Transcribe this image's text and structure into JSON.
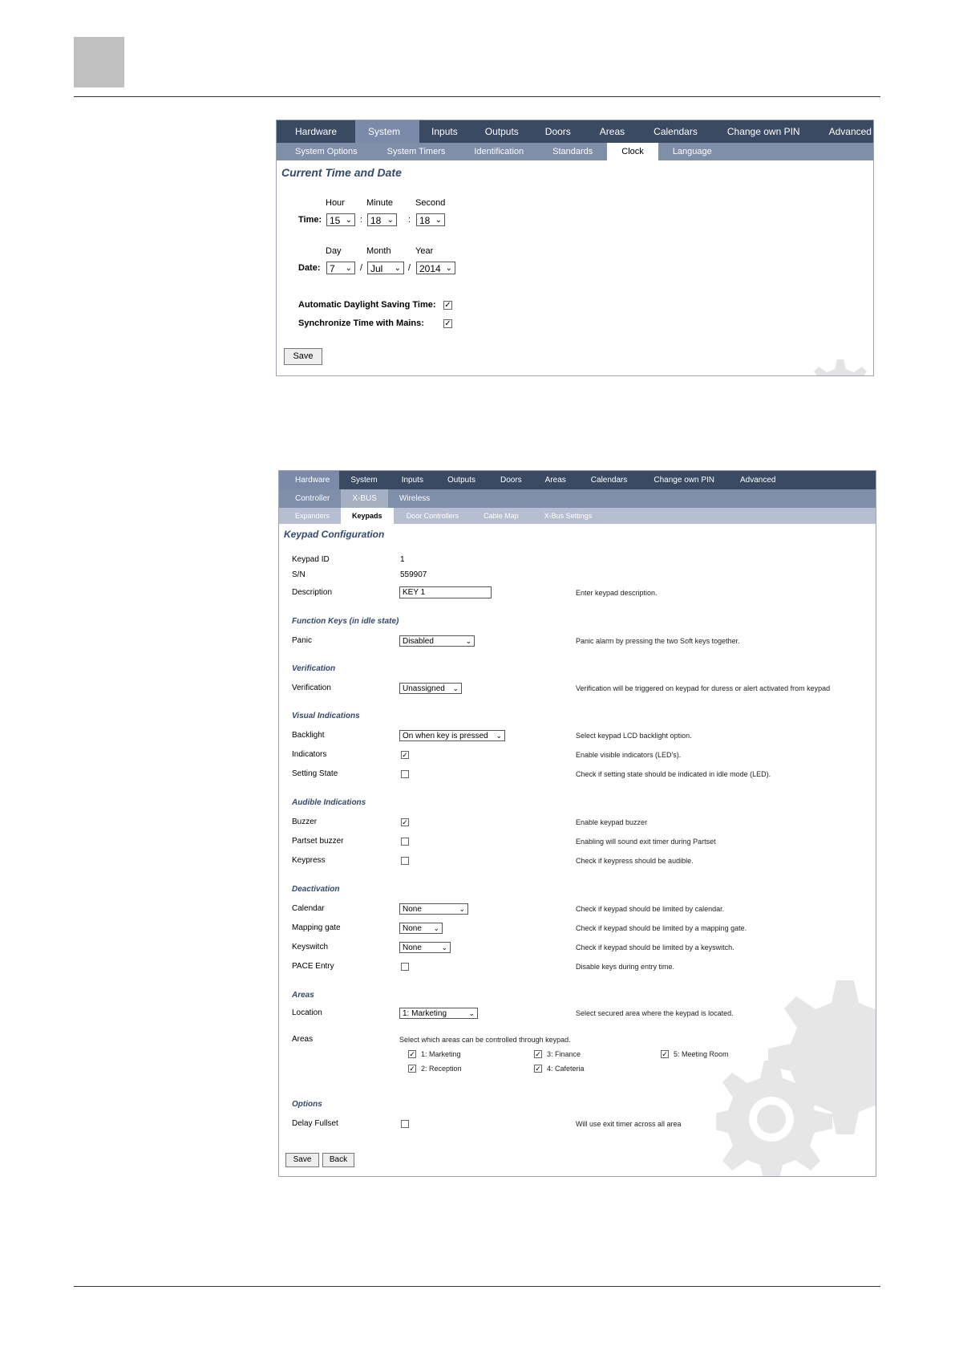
{
  "clock_screen": {
    "nav": [
      "Hardware",
      "System",
      "Inputs",
      "Outputs",
      "Doors",
      "Areas",
      "Calendars",
      "Change own PIN",
      "Advanced"
    ],
    "nav_active": "System",
    "subnav": [
      "System Options",
      "System Timers",
      "Identification",
      "Standards",
      "Clock",
      "Language"
    ],
    "subnav_active": "Clock",
    "title": "Current Time and Date",
    "time_label": "Time:",
    "hour_label": "Hour",
    "minute_label": "Minute",
    "second_label": "Second",
    "hour": "15",
    "minute": "18",
    "second": "18",
    "time_sep1": ":",
    "time_sep2": ":",
    "date_label": "Date:",
    "day_label": "Day",
    "month_label": "Month",
    "year_label": "Year",
    "day": "7",
    "month": "Jul",
    "year": "2014",
    "date_sep1": "/",
    "date_sep2": "/",
    "dst_label": "Automatic Daylight Saving Time:",
    "dst_checked": true,
    "sync_label": "Synchronize Time with Mains:",
    "sync_checked": true,
    "save": "Save"
  },
  "keypad_screen": {
    "nav": [
      "Hardware",
      "System",
      "Inputs",
      "Outputs",
      "Doors",
      "Areas",
      "Calendars",
      "Change own PIN",
      "Advanced"
    ],
    "nav_active": "Hardware",
    "subnav1": [
      "Controller",
      "X-BUS",
      "Wireless"
    ],
    "subnav1_active": "X-BUS",
    "subnav2": [
      "Expanders",
      "Keypads",
      "Door Controllers",
      "Cable Map",
      "X-Bus Settings"
    ],
    "subnav2_active": "Keypads",
    "title": "Keypad Configuration",
    "keypad_id_label": "Keypad ID",
    "keypad_id": "1",
    "sn_label": "S/N",
    "sn": "559907",
    "description_label": "Description",
    "description_value": "KEY 1",
    "description_hint": "Enter keypad description.",
    "function_keys_title": "Function Keys (in idle state)",
    "panic_label": "Panic",
    "panic_value": "Disabled",
    "panic_hint": "Panic alarm by pressing the two Soft keys together.",
    "verification_title": "Verification",
    "verification_label": "Verification",
    "verification_value": "Unassigned",
    "verification_hint": "Verification will be triggered on keypad for duress or alert activated from keypad",
    "visual_title": "Visual Indications",
    "backlight_label": "Backlight",
    "backlight_value": "On when key is pressed",
    "backlight_hint": "Select keypad LCD backlight option.",
    "indicators_label": "Indicators",
    "indicators_checked": true,
    "indicators_hint": "Enable visible indicators (LED's).",
    "setting_state_label": "Setting State",
    "setting_state_checked": false,
    "setting_state_hint": "Check if setting state should be indicated in idle mode (LED).",
    "audible_title": "Audible Indications",
    "buzzer_label": "Buzzer",
    "buzzer_checked": true,
    "buzzer_hint": "Enable keypad buzzer",
    "partset_label": "Partset buzzer",
    "partset_checked": false,
    "partset_hint": "Enabling will sound exit timer during Partset",
    "keypress_label": "Keypress",
    "keypress_checked": false,
    "keypress_hint": "Check if keypress should be audible.",
    "deactivation_title": "Deactivation",
    "calendar_label": "Calendar",
    "calendar_value": "None",
    "calendar_hint": "Check if keypad should be limited by calendar.",
    "mapping_label": "Mapping gate",
    "mapping_value": "None",
    "mapping_hint": "Check if keypad should be limited by a mapping gate.",
    "keyswitch_label": "Keyswitch",
    "keyswitch_value": "None",
    "keyswitch_hint": "Check if keypad should be limited by a keyswitch.",
    "pace_label": "PACE Entry",
    "pace_checked": false,
    "pace_hint": "Disable keys during entry time.",
    "areas_title": "Areas",
    "location_label": "Location",
    "location_value": "1: Marketing",
    "location_hint": "Select secured area where the keypad is located.",
    "areas_label": "Areas",
    "areas_hint": "Select which areas can be controlled through keypad.",
    "areas_list": [
      {
        "label": "1: Marketing",
        "checked": true
      },
      {
        "label": "3: Finance",
        "checked": true
      },
      {
        "label": "5: Meeting Room",
        "checked": true
      },
      {
        "label": "2: Reception",
        "checked": true
      },
      {
        "label": "4: Cafeteria",
        "checked": true
      }
    ],
    "options_title": "Options",
    "delay_label": "Delay Fullset",
    "delay_checked": false,
    "delay_hint": "Will use exit timer across all area",
    "save": "Save",
    "back": "Back"
  },
  "icons": {
    "chevron": "chevron-down-icon",
    "check": "check-icon",
    "gear": "gear-icon"
  },
  "colors": {
    "nav_dark": "#3b4a63",
    "nav_mid": "#7f8ea9",
    "nav_light": "#b5bfd0",
    "title_blue": "#33496b"
  }
}
